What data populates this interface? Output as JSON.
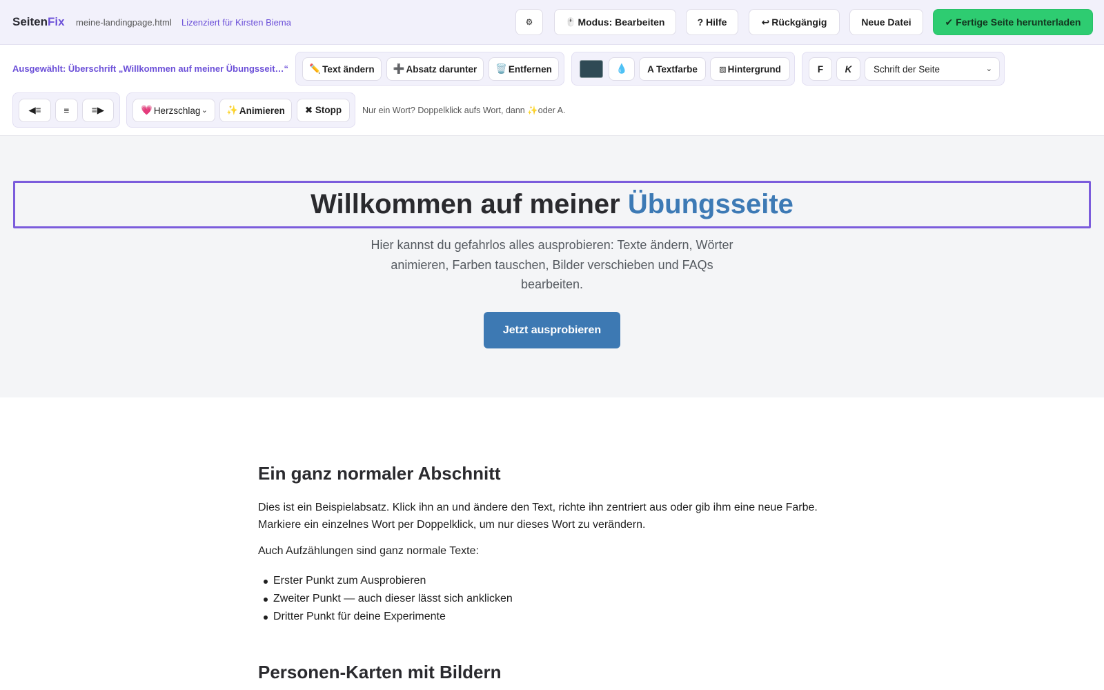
{
  "app": {
    "brand_main": "Seiten",
    "brand_accent": "Fix",
    "filename": "meine-landingpage.html",
    "license": "Lizenziert für Kirsten Biema"
  },
  "topbar": {
    "settings_icon": "⚙",
    "mode_icon": "🖱️",
    "mode_label": "Modus: Bearbeiten",
    "help_label": "? Hilfe",
    "undo_icon": "↩",
    "undo_label": "Rückgängig",
    "new_file_label": "Neue Datei",
    "download_label": "✔ Fertige Seite herunterladen"
  },
  "toolbar": {
    "selected_label": "Ausgewählt: Überschrift „Willkommen auf meiner Übungsseit…“",
    "edit_text_icon": "✏️",
    "edit_text_label": "Text ändern",
    "add_paragraph_icon": "➕",
    "add_paragraph_label": "Absatz darunter",
    "remove_icon": "🗑️",
    "remove_label": "Entfernen",
    "text_color_swatch": "#2f4a55",
    "eyedropper_icon": "💧",
    "text_color_label": "A Textfarbe",
    "background_icon": "▨",
    "background_label": "Hintergrund",
    "bold_label": "F",
    "italic_label": "K",
    "font_select_value": "Schrift der Seite",
    "align_left_label": "◀≡",
    "align_center_label": "≡",
    "align_right_label": "≡▶",
    "animation_icon": "💗",
    "animation_select_value": "Herzschlag",
    "animate_icon": "✨",
    "animate_label": "Animieren",
    "stop_label": "✖ Stopp",
    "hint": "Nur ein Wort? Doppelklick aufs Wort, dann ✨oder A."
  },
  "hero": {
    "title_plain": "Willkommen auf meiner ",
    "title_highlight": "Übungsseite",
    "subtitle": "Hier kannst du gefahrlos alles ausprobieren: Texte ändern, Wörter animieren, Farben tauschen, Bilder verschieben und FAQs bearbeiten.",
    "cta_label": "Jetzt ausprobieren"
  },
  "section": {
    "heading": "Ein ganz normaler Abschnitt",
    "paragraph": "Dies ist ein Beispielabsatz. Klick ihn an und ändere den Text, richte ihn zentriert aus oder gib ihm eine neue Farbe. Markiere ein einzelnes Wort per Doppelklick, um nur dieses Wort zu verändern.",
    "list_intro": "Auch Aufzählungen sind ganz normale Texte:",
    "list_items": [
      "Erster Punkt zum Ausprobieren",
      "Zweiter Punkt — auch dieser lässt sich anklicken",
      "Dritter Punkt für deine Experimente"
    ],
    "next_heading": "Personen-Karten mit Bildern"
  },
  "colors": {
    "accent": "#6b4fd8",
    "hero_highlight": "#3d7ab5",
    "cta": "#3d79b3",
    "download": "#2ecc71"
  }
}
